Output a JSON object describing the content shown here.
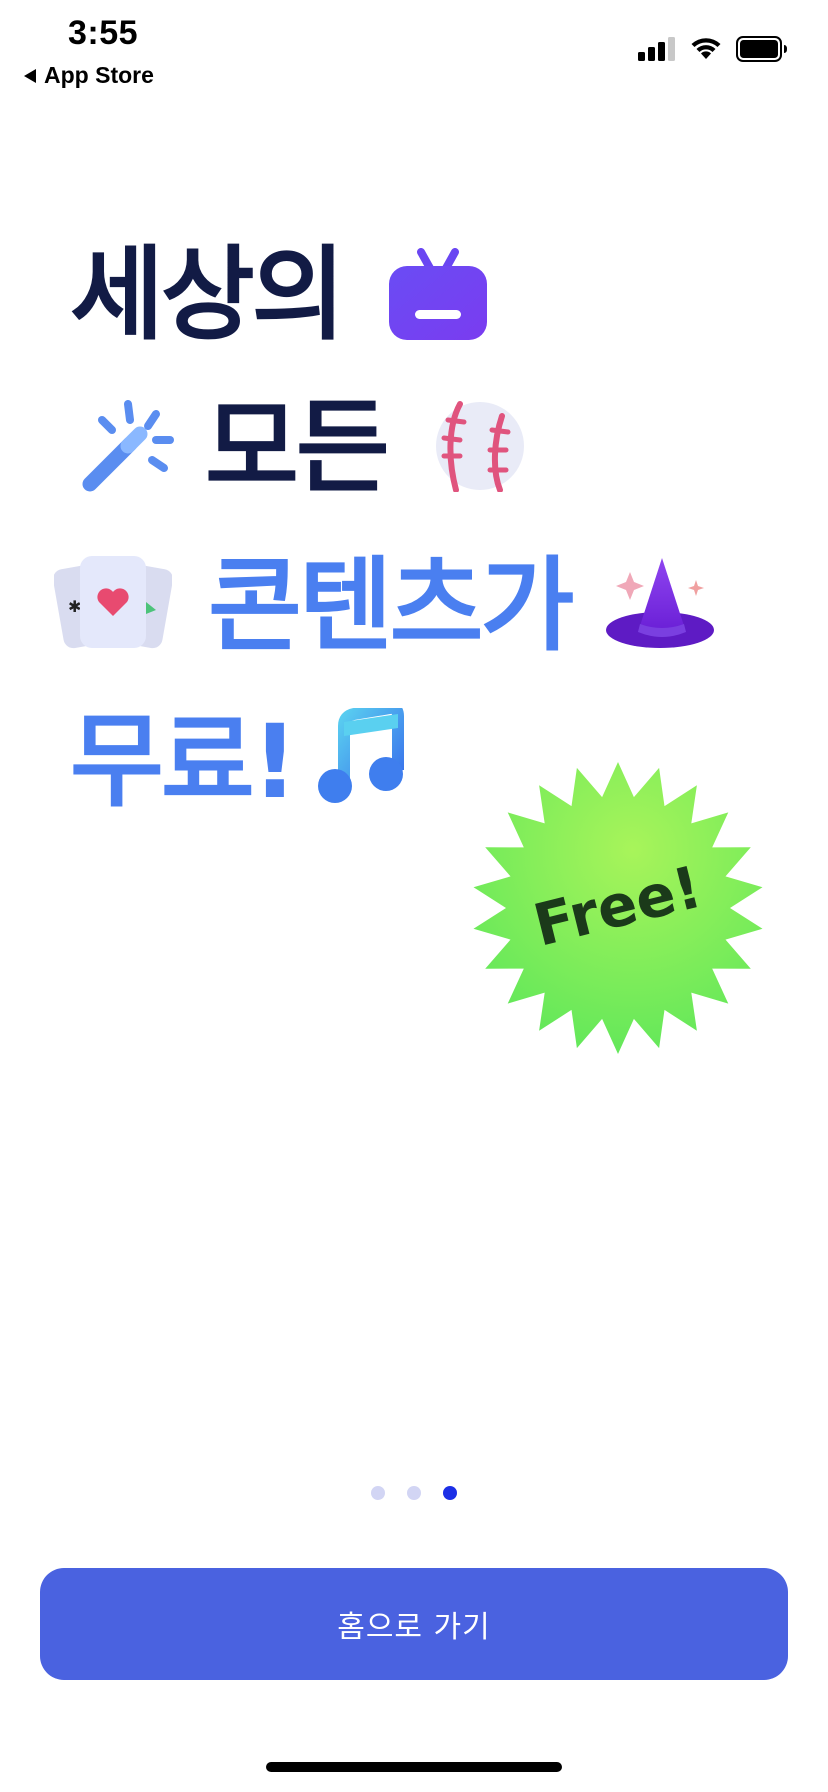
{
  "status_bar": {
    "time": "3:55",
    "back_label": "App Store"
  },
  "headline": {
    "line1": "세상의",
    "line2": "모든",
    "line3": "콘텐츠가",
    "line4": "무료!"
  },
  "badge": {
    "text": "Free!"
  },
  "pagination": {
    "total": 3,
    "active_index": 3
  },
  "cta": {
    "label": "홈으로 가기"
  },
  "colors": {
    "headline_dark": "#121b45",
    "headline_blue": "#4a7ff0",
    "cta_background": "#4a62e0",
    "dot_active": "#1c2fe6",
    "dot_inactive": "#d2d5f4",
    "badge_green": "#6be65a"
  },
  "icons": {
    "line1": "tv-icon",
    "line2_left": "magic-wand-icon",
    "line2_right": "baseball-icon",
    "line3_left": "playing-cards-icon",
    "line3_right": "wizard-hat-icon",
    "line4": "music-note-icon"
  }
}
